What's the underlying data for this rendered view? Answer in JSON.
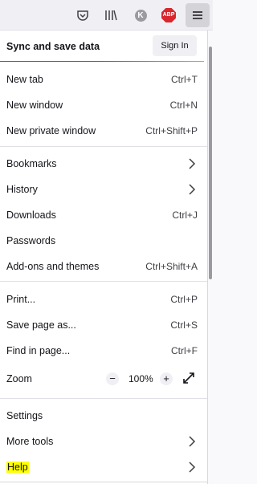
{
  "toolbar": {
    "icons": [
      "pocket-icon",
      "library-icon",
      "k-extension-icon",
      "adblock-plus-icon",
      "hamburger-menu-icon"
    ],
    "k_letter": "K",
    "abp_text": "ABP"
  },
  "sync": {
    "label": "Sync and save data",
    "sign_in": "Sign In"
  },
  "menu": {
    "new_tab": {
      "label": "New tab",
      "shortcut": "Ctrl+T"
    },
    "new_window": {
      "label": "New window",
      "shortcut": "Ctrl+N"
    },
    "new_private_window": {
      "label": "New private window",
      "shortcut": "Ctrl+Shift+P"
    },
    "bookmarks": {
      "label": "Bookmarks"
    },
    "history": {
      "label": "History"
    },
    "downloads": {
      "label": "Downloads",
      "shortcut": "Ctrl+J"
    },
    "passwords": {
      "label": "Passwords"
    },
    "addons": {
      "label": "Add-ons and themes",
      "shortcut": "Ctrl+Shift+A"
    },
    "print": {
      "label": "Print...",
      "shortcut": "Ctrl+P"
    },
    "save_page": {
      "label": "Save page as...",
      "shortcut": "Ctrl+S"
    },
    "find": {
      "label": "Find in page...",
      "shortcut": "Ctrl+F"
    },
    "zoom": {
      "label": "Zoom",
      "minus": "−",
      "value": "100%",
      "plus": "+"
    },
    "settings": {
      "label": "Settings"
    },
    "more_tools": {
      "label": "More tools"
    },
    "help": {
      "label": "Help"
    }
  },
  "colors": {
    "help_highlight": "#ffff00",
    "abp_red": "#d9272e"
  }
}
